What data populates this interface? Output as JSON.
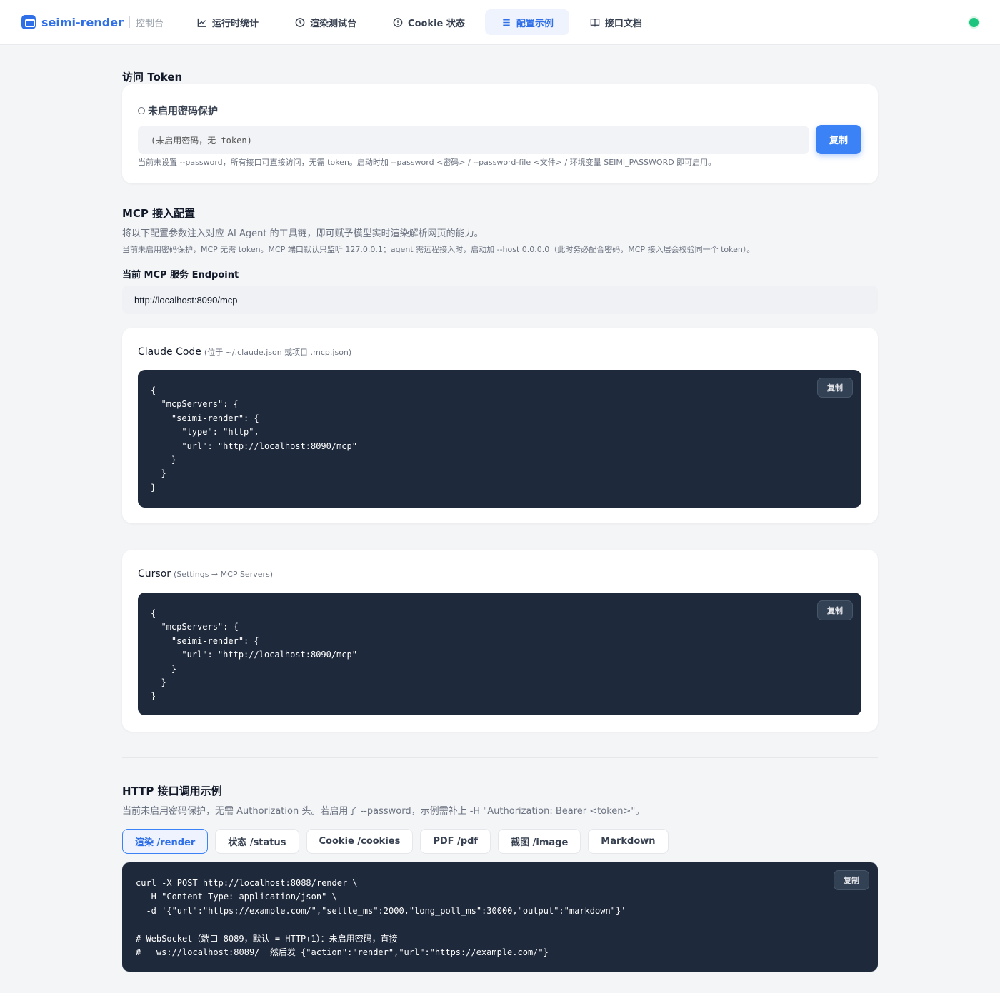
{
  "header": {
    "brand": "seimi-render",
    "subtitle": "控制台",
    "nav": [
      {
        "label": "运行时统计",
        "icon": "line-chart-icon",
        "active": false
      },
      {
        "label": "渲染测试台",
        "icon": "clock-icon",
        "active": false
      },
      {
        "label": "Cookie 状态",
        "icon": "info-icon",
        "active": false
      },
      {
        "label": "配置示例",
        "icon": "menu-icon",
        "active": true
      },
      {
        "label": "接口文档",
        "icon": "book-icon",
        "active": false
      }
    ],
    "status_color": "#1cc47d"
  },
  "token": {
    "section_title": "访问 Token",
    "status": "未启用密码保护",
    "value": "(未启用密码，无 token)",
    "copy_label": "复制",
    "hint": "当前未设置 --password，所有接口可直接访问，无需 token。启动时加 --password <密码> / --password-file <文件> / 环境变量 SEIMI_PASSWORD 即可启用。"
  },
  "mcp": {
    "section_title": "MCP 接入配置",
    "description": "将以下配置参数注入对应 AI Agent 的工具链，即可赋予模型实时渲染解析网页的能力。",
    "note": "当前未启用密码保护，MCP 无需 token。MCP 端口默认只监听 127.0.0.1；agent 需远程接入时，启动加 --host 0.0.0.0（此时务必配合密码，MCP 接入层会校验同一个 token）。",
    "endpoint_label": "当前 MCP 服务 Endpoint",
    "endpoint": "http://localhost:8090/mcp",
    "configs": [
      {
        "title": "Claude Code",
        "subtitle": "(位于 ~/.claude.json 或项目 .mcp.json)",
        "copy_label": "复制",
        "code": "{\n  \"mcpServers\": {\n    \"seimi-render\": {\n      \"type\": \"http\",\n      \"url\": \"http://localhost:8090/mcp\"\n    }\n  }\n}"
      },
      {
        "title": "Cursor",
        "subtitle": "(Settings → MCP Servers)",
        "copy_label": "复制",
        "code": "{\n  \"mcpServers\": {\n    \"seimi-render\": {\n      \"url\": \"http://localhost:8090/mcp\"\n    }\n  }\n}"
      }
    ]
  },
  "http": {
    "section_title": "HTTP 接口调用示例",
    "description": "当前未启用密码保护，无需 Authorization 头。若启用了 --password，示例需补上 -H \"Authorization: Bearer <token>\"。",
    "tabs": [
      {
        "label": "渲染 /render",
        "active": true
      },
      {
        "label": "状态 /status",
        "active": false
      },
      {
        "label": "Cookie /cookies",
        "active": false
      },
      {
        "label": "PDF /pdf",
        "active": false
      },
      {
        "label": "截图 /image",
        "active": false
      },
      {
        "label": "Markdown",
        "active": false
      }
    ],
    "copy_label": "复制",
    "code": "curl -X POST http://localhost:8088/render \\\n  -H \"Content-Type: application/json\" \\\n  -d '{\"url\":\"https://example.com/\",\"settle_ms\":2000,\"long_poll_ms\":30000,\"output\":\"markdown\"}'\n\n# WebSocket（端口 8089，默认 = HTTP+1）：未启用密码，直接\n#   ws://localhost:8089/  然后发 {\"action\":\"render\",\"url\":\"https://example.com/\"}"
  }
}
